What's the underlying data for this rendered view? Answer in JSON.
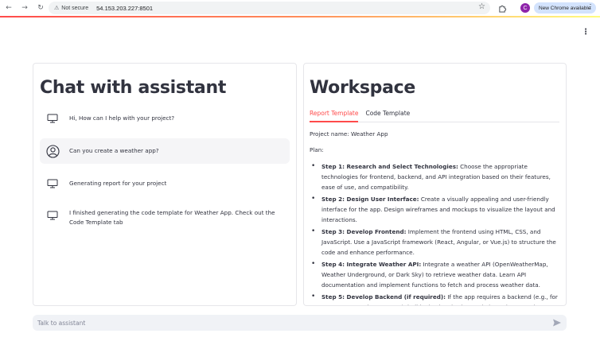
{
  "browser": {
    "security_label": "Not secure",
    "url": "54.153.203.227:8501",
    "new_chrome_label": "New Chrome available",
    "profile_initial": "C"
  },
  "chat": {
    "title": "Chat with assistant",
    "messages": [
      {
        "role": "assistant",
        "icon": "computer-icon",
        "text": "Hi, How can I help with your project?"
      },
      {
        "role": "user",
        "icon": "user-icon",
        "text": "Can you create a weather app?"
      },
      {
        "role": "assistant",
        "icon": "computer-icon",
        "text": "Generating report for your project"
      },
      {
        "role": "assistant",
        "icon": "computer-icon",
        "text": "I finished generating the code template for Weather App. Check out the Code Template tab"
      }
    ],
    "input_placeholder": "Talk to assistant"
  },
  "workspace": {
    "title": "Workspace",
    "tabs": [
      "Report Template",
      "Code Template"
    ],
    "active_tab": "Report Template",
    "project_name": "Project name: Weather App",
    "plan_label": "Plan:",
    "steps": [
      {
        "title": "Step 1: Research and Select Technologies:",
        "text": " Choose the appropriate technologies for frontend, backend, and API integration based on their features, ease of use, and compatibility."
      },
      {
        "title": "Step 2: Design User Interface:",
        "text": " Create a visually appealing and user-friendly interface for the app. Design wireframes and mockups to visualize the layout and interactions."
      },
      {
        "title": "Step 3: Develop Frontend:",
        "text": " Implement the frontend using HTML, CSS, and JavaScript. Use a JavaScript framework (React, Angular, or Vue.js) to structure the code and enhance performance."
      },
      {
        "title": "Step 4: Integrate Weather API:",
        "text": " Integrate a weather API (OpenWeatherMap, Weather Underground, or Dark Sky) to retrieve weather data. Learn API documentation and implement functions to fetch and process weather data."
      },
      {
        "title": "Step 5: Develop Backend (if required):",
        "text": " If the app requires a backend (e.g., for user accounts, data storage), build a backend using Node.js, Python, or other suitable technologies."
      }
    ]
  },
  "colors": {
    "accent": "#ff4b4b",
    "text": "#31333f",
    "user_bubble": "#f5f5f7",
    "input_bg": "#f0f2f6"
  }
}
